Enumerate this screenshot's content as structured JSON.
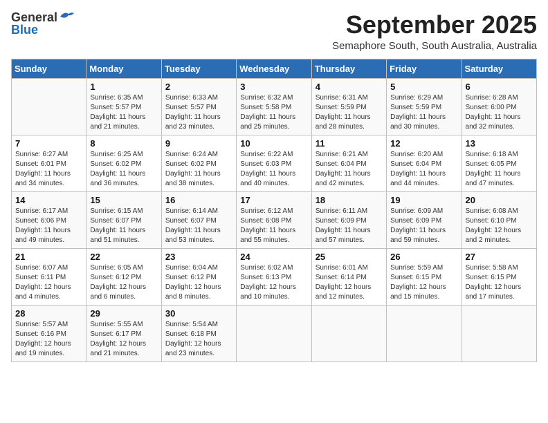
{
  "header": {
    "logo_general": "General",
    "logo_blue": "Blue",
    "month_title": "September 2025",
    "subtitle": "Semaphore South, South Australia, Australia"
  },
  "days_of_week": [
    "Sunday",
    "Monday",
    "Tuesday",
    "Wednesday",
    "Thursday",
    "Friday",
    "Saturday"
  ],
  "weeks": [
    [
      {
        "day": "",
        "info": ""
      },
      {
        "day": "1",
        "info": "Sunrise: 6:35 AM\nSunset: 5:57 PM\nDaylight: 11 hours\nand 21 minutes."
      },
      {
        "day": "2",
        "info": "Sunrise: 6:33 AM\nSunset: 5:57 PM\nDaylight: 11 hours\nand 23 minutes."
      },
      {
        "day": "3",
        "info": "Sunrise: 6:32 AM\nSunset: 5:58 PM\nDaylight: 11 hours\nand 25 minutes."
      },
      {
        "day": "4",
        "info": "Sunrise: 6:31 AM\nSunset: 5:59 PM\nDaylight: 11 hours\nand 28 minutes."
      },
      {
        "day": "5",
        "info": "Sunrise: 6:29 AM\nSunset: 5:59 PM\nDaylight: 11 hours\nand 30 minutes."
      },
      {
        "day": "6",
        "info": "Sunrise: 6:28 AM\nSunset: 6:00 PM\nDaylight: 11 hours\nand 32 minutes."
      }
    ],
    [
      {
        "day": "7",
        "info": "Sunrise: 6:27 AM\nSunset: 6:01 PM\nDaylight: 11 hours\nand 34 minutes."
      },
      {
        "day": "8",
        "info": "Sunrise: 6:25 AM\nSunset: 6:02 PM\nDaylight: 11 hours\nand 36 minutes."
      },
      {
        "day": "9",
        "info": "Sunrise: 6:24 AM\nSunset: 6:02 PM\nDaylight: 11 hours\nand 38 minutes."
      },
      {
        "day": "10",
        "info": "Sunrise: 6:22 AM\nSunset: 6:03 PM\nDaylight: 11 hours\nand 40 minutes."
      },
      {
        "day": "11",
        "info": "Sunrise: 6:21 AM\nSunset: 6:04 PM\nDaylight: 11 hours\nand 42 minutes."
      },
      {
        "day": "12",
        "info": "Sunrise: 6:20 AM\nSunset: 6:04 PM\nDaylight: 11 hours\nand 44 minutes."
      },
      {
        "day": "13",
        "info": "Sunrise: 6:18 AM\nSunset: 6:05 PM\nDaylight: 11 hours\nand 47 minutes."
      }
    ],
    [
      {
        "day": "14",
        "info": "Sunrise: 6:17 AM\nSunset: 6:06 PM\nDaylight: 11 hours\nand 49 minutes."
      },
      {
        "day": "15",
        "info": "Sunrise: 6:15 AM\nSunset: 6:07 PM\nDaylight: 11 hours\nand 51 minutes."
      },
      {
        "day": "16",
        "info": "Sunrise: 6:14 AM\nSunset: 6:07 PM\nDaylight: 11 hours\nand 53 minutes."
      },
      {
        "day": "17",
        "info": "Sunrise: 6:12 AM\nSunset: 6:08 PM\nDaylight: 11 hours\nand 55 minutes."
      },
      {
        "day": "18",
        "info": "Sunrise: 6:11 AM\nSunset: 6:09 PM\nDaylight: 11 hours\nand 57 minutes."
      },
      {
        "day": "19",
        "info": "Sunrise: 6:09 AM\nSunset: 6:09 PM\nDaylight: 11 hours\nand 59 minutes."
      },
      {
        "day": "20",
        "info": "Sunrise: 6:08 AM\nSunset: 6:10 PM\nDaylight: 12 hours\nand 2 minutes."
      }
    ],
    [
      {
        "day": "21",
        "info": "Sunrise: 6:07 AM\nSunset: 6:11 PM\nDaylight: 12 hours\nand 4 minutes."
      },
      {
        "day": "22",
        "info": "Sunrise: 6:05 AM\nSunset: 6:12 PM\nDaylight: 12 hours\nand 6 minutes."
      },
      {
        "day": "23",
        "info": "Sunrise: 6:04 AM\nSunset: 6:12 PM\nDaylight: 12 hours\nand 8 minutes."
      },
      {
        "day": "24",
        "info": "Sunrise: 6:02 AM\nSunset: 6:13 PM\nDaylight: 12 hours\nand 10 minutes."
      },
      {
        "day": "25",
        "info": "Sunrise: 6:01 AM\nSunset: 6:14 PM\nDaylight: 12 hours\nand 12 minutes."
      },
      {
        "day": "26",
        "info": "Sunrise: 5:59 AM\nSunset: 6:15 PM\nDaylight: 12 hours\nand 15 minutes."
      },
      {
        "day": "27",
        "info": "Sunrise: 5:58 AM\nSunset: 6:15 PM\nDaylight: 12 hours\nand 17 minutes."
      }
    ],
    [
      {
        "day": "28",
        "info": "Sunrise: 5:57 AM\nSunset: 6:16 PM\nDaylight: 12 hours\nand 19 minutes."
      },
      {
        "day": "29",
        "info": "Sunrise: 5:55 AM\nSunset: 6:17 PM\nDaylight: 12 hours\nand 21 minutes."
      },
      {
        "day": "30",
        "info": "Sunrise: 5:54 AM\nSunset: 6:18 PM\nDaylight: 12 hours\nand 23 minutes."
      },
      {
        "day": "",
        "info": ""
      },
      {
        "day": "",
        "info": ""
      },
      {
        "day": "",
        "info": ""
      },
      {
        "day": "",
        "info": ""
      }
    ]
  ]
}
